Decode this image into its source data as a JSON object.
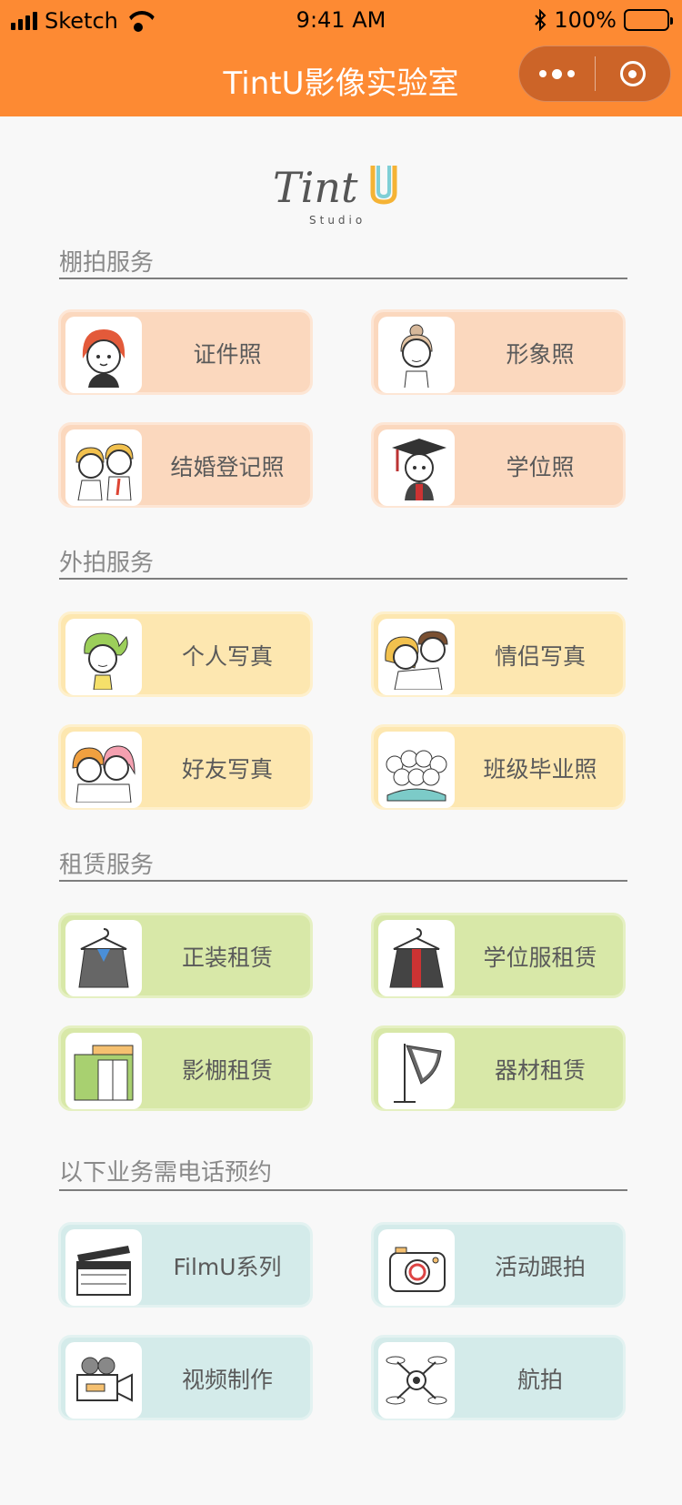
{
  "status_bar": {
    "carrier": "Sketch",
    "time": "9:41 AM",
    "battery": "100%"
  },
  "nav": {
    "title": "TintU影像实验室"
  },
  "logo": {
    "text": "TintU",
    "sub": "Studio"
  },
  "sections": [
    {
      "title": "棚拍服务",
      "items": [
        {
          "label": "证件照",
          "icon": "girl-portrait-icon"
        },
        {
          "label": "形象照",
          "icon": "woman-portrait-icon"
        },
        {
          "label": "结婚登记照",
          "icon": "couple-icon"
        },
        {
          "label": "学位照",
          "icon": "graduation-cap-icon"
        }
      ]
    },
    {
      "title": "外拍服务",
      "items": [
        {
          "label": "个人写真",
          "icon": "girl-portrait-icon"
        },
        {
          "label": "情侣写真",
          "icon": "couple-icon"
        },
        {
          "label": "好友写真",
          "icon": "friends-icon"
        },
        {
          "label": "班级毕业照",
          "icon": "group-icon"
        }
      ]
    },
    {
      "title": "租赁服务",
      "items": [
        {
          "label": "正装租赁",
          "icon": "suit-hanger-icon"
        },
        {
          "label": "学位服租赁",
          "icon": "gown-hanger-icon"
        },
        {
          "label": "影棚租赁",
          "icon": "studio-room-icon"
        },
        {
          "label": "器材租赁",
          "icon": "softbox-light-icon"
        }
      ]
    },
    {
      "title": "以下业务需电话预约",
      "items": [
        {
          "label": "FilmU系列",
          "icon": "clapperboard-icon"
        },
        {
          "label": "活动跟拍",
          "icon": "camera-icon"
        },
        {
          "label": "视频制作",
          "icon": "video-camera-icon"
        },
        {
          "label": "航拍",
          "icon": "drone-icon"
        }
      ]
    }
  ]
}
